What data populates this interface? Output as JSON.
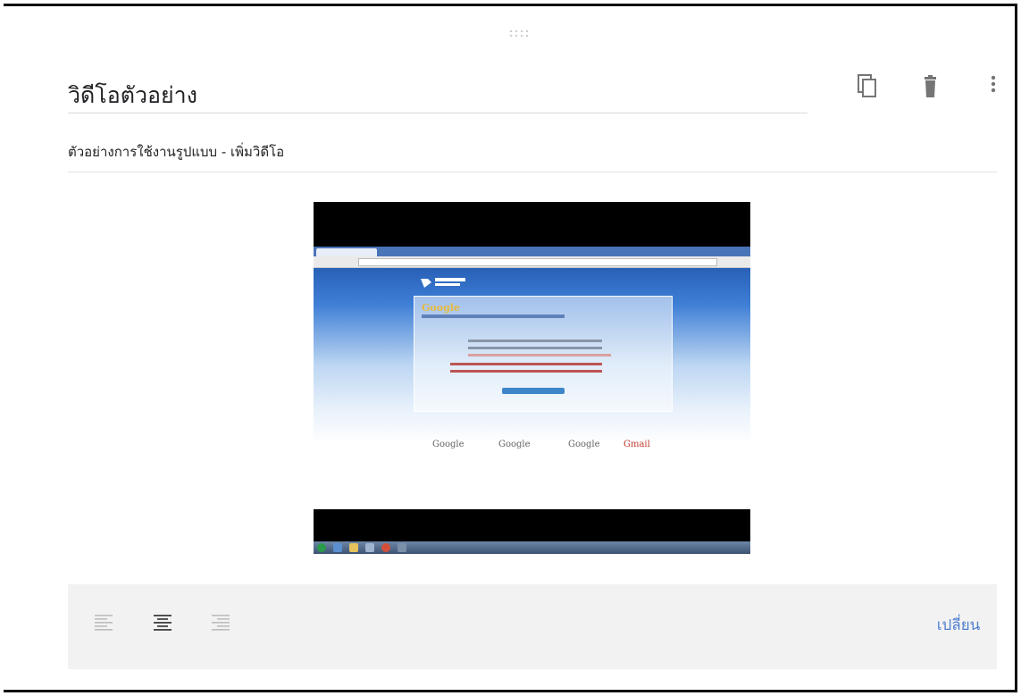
{
  "question": {
    "title": "วิดีโอตัวอย่าง",
    "description": "ตัวอย่างการใช้งานรูปแบบ - เพิ่มวิดีโอ"
  },
  "toolbar": {
    "duplicate_icon": "copy-icon",
    "delete_icon": "trash-icon",
    "more_icon": "more-vert-icon"
  },
  "video": {
    "app_logos": [
      "Google",
      "Google",
      "Google",
      "Gmail"
    ]
  },
  "alignment": {
    "options": [
      "align-left-icon",
      "align-center-icon",
      "align-right-icon"
    ],
    "selected": "align-center",
    "change_label": "เปลี่ยน"
  },
  "colors": {
    "accent": "#4a86e8",
    "link": "#4f7fd0",
    "icon_gray": "#757575"
  }
}
